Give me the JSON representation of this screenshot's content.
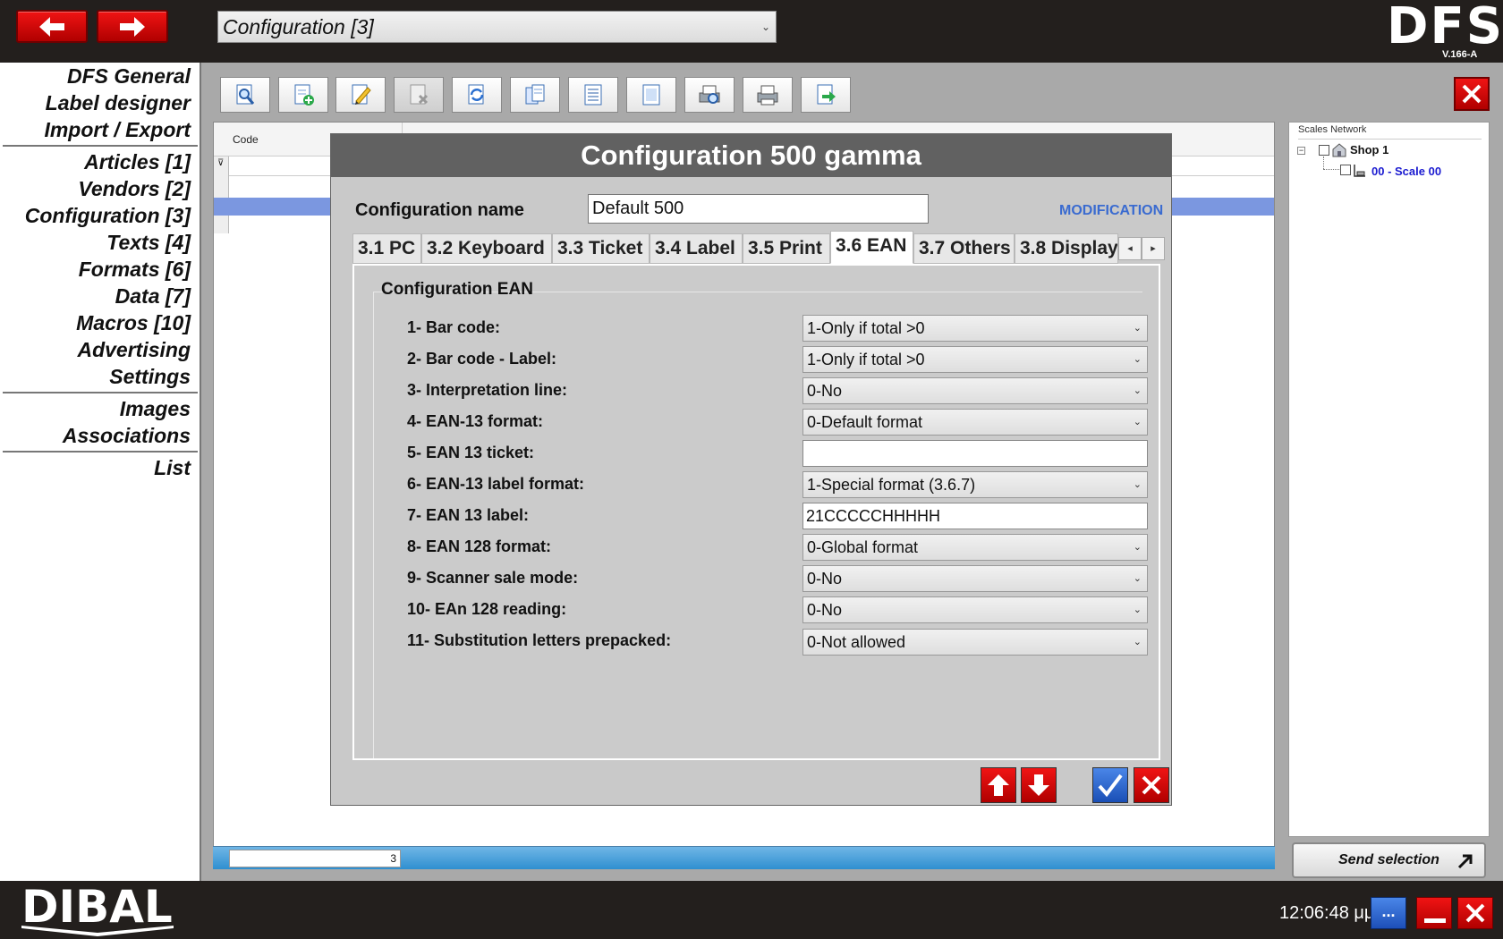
{
  "topbar": {
    "combo_value": "Configuration [3]",
    "logo": "DFS",
    "version": "V.166-A"
  },
  "menu": {
    "items": [
      "DFS General",
      "Label designer",
      "Import / Export",
      "Articles [1]",
      "Vendors [2]",
      "Configuration [3]",
      "Texts [4]",
      "Formats [6]",
      "Data [7]",
      "Macros [10]",
      "Advertising",
      "Settings",
      "Images",
      "Associations",
      "List"
    ]
  },
  "toolbar": {
    "icons": [
      "search-doc-icon",
      "new-doc-icon",
      "edit-doc-icon",
      "delete-doc-icon",
      "refresh-doc-icon",
      "copy-doc-icon",
      "list-doc-icon",
      "page-doc-icon",
      "print-preview-icon",
      "print-icon",
      "export-doc-icon"
    ]
  },
  "grid": {
    "column_code": "Code",
    "record_count": "3"
  },
  "scales": {
    "title": "Scales Network",
    "shop": "Shop 1",
    "scale": "00 - Scale 00",
    "scale_color": "#1a1ad0"
  },
  "send_selection": "Send selection",
  "clock": "12:06:48 μμ",
  "dots_label": "...",
  "dialog": {
    "title": "Configuration 500 gamma",
    "config_name_label": "Configuration name",
    "config_name_value": "Default 500",
    "mode": "MODIFICATION",
    "tabs": [
      "3.1 PC",
      "3.2 Keyboard",
      "3.3 Ticket",
      "3.4 Label",
      "3.5 Print",
      "3.6 EAN",
      "3.7 Others",
      "3.8 Display"
    ],
    "active_tab": "3.6 EAN",
    "group_title": "Configuration EAN",
    "fields": [
      {
        "label": "1- Bar code:",
        "type": "select",
        "value": "1-Only if total >0"
      },
      {
        "label": "2- Bar code - Label:",
        "type": "select",
        "value": "1-Only if total >0"
      },
      {
        "label": "3- Interpretation line:",
        "type": "select",
        "value": "0-No"
      },
      {
        "label": "4- EAN-13 format:",
        "type": "select",
        "value": "0-Default format"
      },
      {
        "label": "5- EAN 13 ticket:",
        "type": "input",
        "value": ""
      },
      {
        "label": "6- EAN-13 label format:",
        "type": "select",
        "value": "1-Special format (3.6.7)"
      },
      {
        "label": "7- EAN 13 label:",
        "type": "input",
        "value": "21CCCCCHHHHH"
      },
      {
        "label": "8- EAN 128 format:",
        "type": "select",
        "value": "0-Global format"
      },
      {
        "label": "9- Scanner sale mode:",
        "type": "select",
        "value": "0-No"
      },
      {
        "label": "10- EAn 128 reading:",
        "type": "select",
        "value": "0-No"
      },
      {
        "label": "11- Substitution letters prepacked:",
        "type": "select",
        "value": "0-Not allowed"
      }
    ]
  },
  "brand": "DIBAL",
  "colors": {
    "accent_red": "#d00000",
    "accent_blue": "#2a62cf",
    "titlebar": "#616161",
    "selection_row": "#7b97e0"
  }
}
